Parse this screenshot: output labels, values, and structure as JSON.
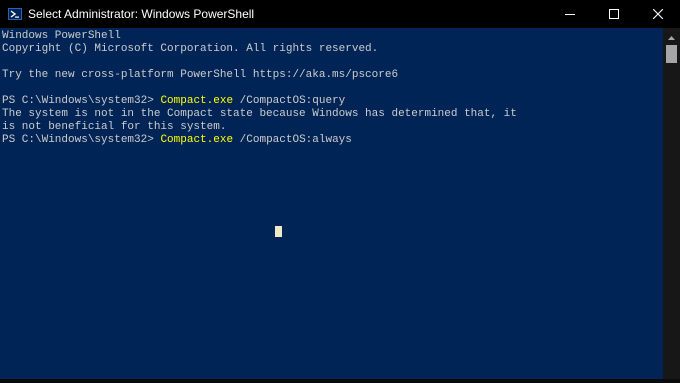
{
  "window": {
    "title": "Select Administrator: Windows PowerShell",
    "icon": "powershell-icon",
    "controls": [
      "minimize-icon",
      "maximize-icon",
      "close-icon"
    ],
    "colors": {
      "titlebar_bg": "#000000",
      "console_bg": "#012456",
      "console_text": "#cccccc",
      "command_text": "#ffff00"
    }
  },
  "console": {
    "lines": {
      "l1": "Windows PowerShell",
      "l2": "Copyright (C) Microsoft Corporation. All rights reserved.",
      "l3": "Try the new cross-platform PowerShell https://aka.ms/pscore6",
      "l4_prompt": "PS C:\\Windows\\system32> ",
      "l4_cmd": "Compact.exe",
      "l4_args": " /CompactOS:query",
      "l5": "The system is not in the Compact state because Windows has determined that, it",
      "l6": "is not beneficial for this system.",
      "l7_prompt": "PS C:\\Windows\\system32> ",
      "l7_cmd": "Compact.exe",
      "l7_args": " /CompactOS:always"
    }
  }
}
